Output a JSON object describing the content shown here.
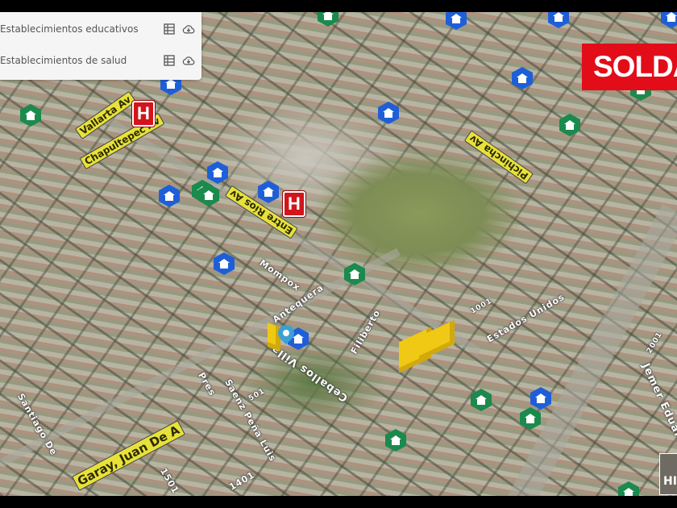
{
  "layers_panel": {
    "items": [
      {
        "label": "Establecimientos educativos",
        "icons": [
          "table-icon",
          "cloud-download-icon"
        ]
      },
      {
        "label": "Establecimientos de salud",
        "icons": [
          "table-icon",
          "cloud-download-icon"
        ]
      }
    ]
  },
  "badge": {
    "label": "SOLDA",
    "color": "#e20d18"
  },
  "basemap_toggle": {
    "label": "HI"
  },
  "streets": {
    "yellow": [
      "Vallarta Av",
      "Chapultepec Av",
      "Entre Ríos Av",
      "Pichincha Av",
      "Garay, Juan De A"
    ],
    "white": [
      "Ceballos Villa",
      "Saenz Peña Luis",
      "Pres",
      "Filiberto",
      "Antequera",
      "Mompox",
      "Jemer Eduardo Dr",
      "Estados Unidos",
      "Santiago De",
      "1501",
      "1401",
      "1001",
      "2001",
      "501"
    ]
  },
  "marker_types": {
    "education": {
      "icon": "school-icon",
      "color": "#1e5fd8",
      "count": 12
    },
    "health": {
      "icon": "health-center-icon",
      "color": "#1a8a4d",
      "count": 10
    },
    "hospital": {
      "icon": "hospital-icon",
      "label": "H",
      "color": "#d1151b",
      "count": 2
    }
  }
}
